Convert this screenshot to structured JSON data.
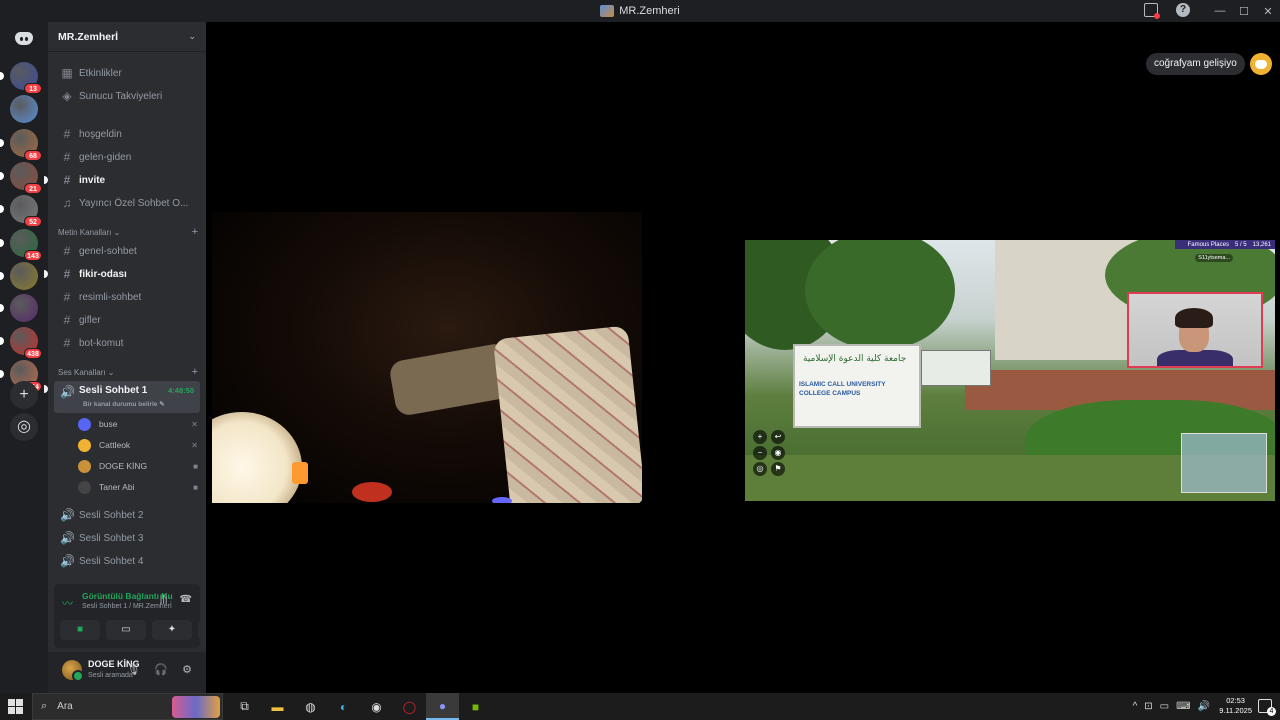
{
  "window": {
    "title": "MR.Zemheri"
  },
  "servers": [
    {
      "badge": "13",
      "color": "#3a4a9a"
    },
    {
      "badge": "",
      "color": "#5b8fd6"
    },
    {
      "badge": "68",
      "color": "#a36a3c"
    },
    {
      "badge": "21",
      "color": "#8a4a3a"
    },
    {
      "badge": "52",
      "color": "#7a7a7a"
    },
    {
      "badge": "143",
      "color": "#2a6a3a"
    },
    {
      "badge": "",
      "color": "#8a7a2a"
    },
    {
      "badge": "",
      "color": "#5a2a6a"
    },
    {
      "badge": "438",
      "color": "#c0302a"
    },
    {
      "badge": "644",
      "color": "#b86a4a"
    }
  ],
  "guild": {
    "name": "MR.Zemherİ"
  },
  "nav_top": [
    {
      "label": "Etkinlikler",
      "icon": "calendar-icon",
      "glyph": "▦"
    },
    {
      "label": "Sunucu Takviyeleri",
      "icon": "boost-icon",
      "glyph": "◈"
    }
  ],
  "channels_top": [
    {
      "label": "hoşgeldin",
      "glyph": "#",
      "bold": false
    },
    {
      "label": "gelen-giden",
      "glyph": "#",
      "bold": false
    },
    {
      "label": "invite",
      "glyph": "#",
      "bold": true
    },
    {
      "label": "Yayıncı Özel Sohbet O...",
      "glyph": "♫",
      "bold": false
    }
  ],
  "text_category": {
    "label": "Metin Kanalları ⌄",
    "plus": "+"
  },
  "text_channels": [
    {
      "label": "genel-sohbet",
      "bold": false
    },
    {
      "label": "fikir-odası",
      "bold": true
    },
    {
      "label": "resimli-sohbet",
      "bold": false
    },
    {
      "label": "gifler",
      "bold": false
    },
    {
      "label": "bot-komut",
      "bold": false
    }
  ],
  "voice_category": {
    "label": "Ses Kanalları ⌄",
    "plus": "+"
  },
  "active_voice": {
    "label": "Sesli Sohbet 1",
    "time": "4:48:50",
    "status": "Bir kanal durumu belirle ✎"
  },
  "voice_users": [
    {
      "name": "buse",
      "color": "#5865f2",
      "status": "✕"
    },
    {
      "name": "Cattleok",
      "color": "#f0b232",
      "status": "✕"
    },
    {
      "name": "DOGE KİNG",
      "color": "#c9923a",
      "status": "■"
    },
    {
      "name": "Taner Abi",
      "color": "#444",
      "status": "■"
    }
  ],
  "voice_channels": [
    {
      "label": "Sesli Sohbet 2"
    },
    {
      "label": "Sesli Sohbet 3"
    },
    {
      "label": "Sesli Sohbet 4"
    }
  ],
  "rtc": {
    "connection": "Görüntülü Bağlantı Ku",
    "channel": "Sesli Sohbet 1 / MR.Zemherİ",
    "buttons": [
      "camera-icon",
      "screen-share-icon",
      "activity-icon",
      "soundboard-icon"
    ]
  },
  "user": {
    "name": "DOGE KİNG",
    "status": "Sesli aramada"
  },
  "stage": {
    "tooltip": "coğrafyam gelişiyo",
    "stream": {
      "topbar": [
        "Famous Places",
        "5 / 5",
        "13,261"
      ],
      "player": "S11ytsema...",
      "sign_arabic": "جامعة كلية الدعوة الإسلامية",
      "sign_english": "ISLAMIC CALL UNIVERSITY COLLEGE CAMPUS"
    }
  },
  "taskbar": {
    "search_placeholder": "Ara",
    "time": "02:53",
    "date": "9.11.2025"
  }
}
